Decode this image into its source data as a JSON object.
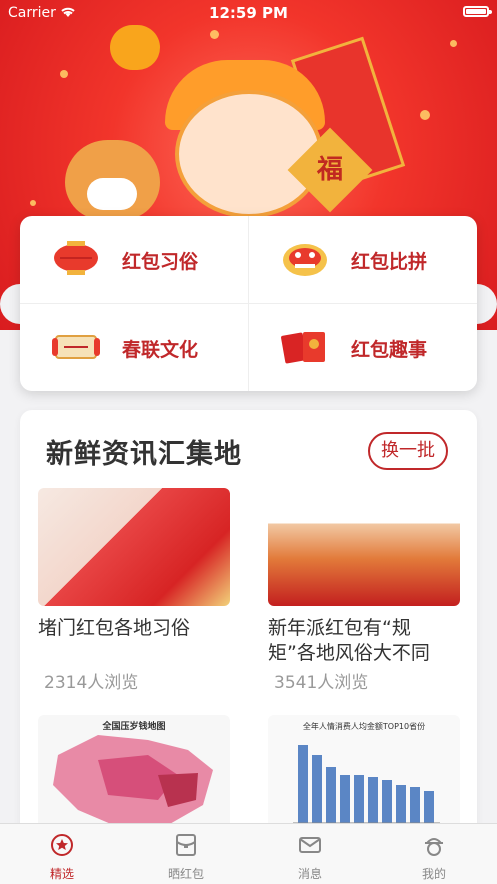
{
  "status_bar": {
    "carrier": "Carrier",
    "time": "12:59 PM"
  },
  "banner": {
    "fu_char": "福"
  },
  "menu": {
    "items": [
      {
        "label": "红包习俗",
        "icon": "lantern-icon"
      },
      {
        "label": "红包比拼",
        "icon": "lion-dance-icon"
      },
      {
        "label": "春联文化",
        "icon": "couplet-scroll-icon"
      },
      {
        "label": "红包趣事",
        "icon": "red-envelopes-icon"
      }
    ]
  },
  "news": {
    "title": "新鲜资讯汇集地",
    "refresh_label": "换一批",
    "articles": [
      {
        "title": "堵门红包各地习俗",
        "views": "2314人浏览"
      },
      {
        "title": "新年派红包有“规矩”各地风俗大不同",
        "views": "3541人浏览"
      },
      {
        "title": "全国压岁钱地图",
        "views": ""
      },
      {
        "title": "全年人情消费人均金额TOP10省份",
        "views": ""
      }
    ]
  },
  "tabbar": {
    "tabs": [
      {
        "label": "精选",
        "icon": "featured-icon",
        "active": true
      },
      {
        "label": "晒红包",
        "icon": "share-envelope-icon",
        "active": false
      },
      {
        "label": "消息",
        "icon": "message-icon",
        "active": false
      },
      {
        "label": "我的",
        "icon": "profile-icon",
        "active": false
      }
    ]
  },
  "colors": {
    "accent": "#c0282a",
    "hero": "#f2352b"
  }
}
